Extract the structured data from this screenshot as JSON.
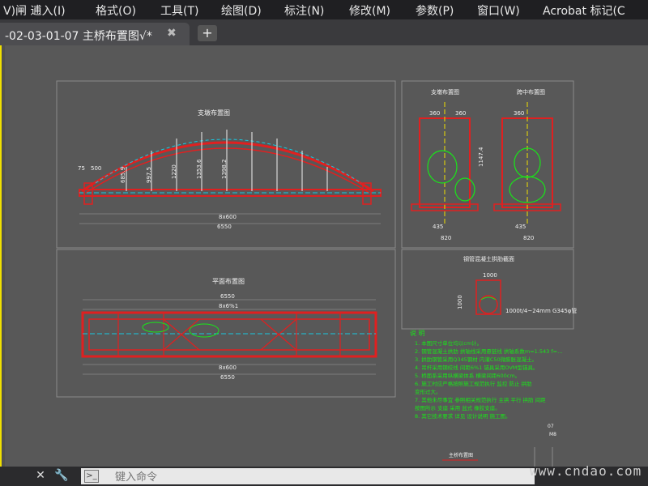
{
  "menu": {
    "items": [
      "V)闸 逋入(I)",
      "格式(O)",
      "工具(T)",
      "绘图(D)",
      "标注(N)",
      "修改(M)",
      "参数(P)",
      "窗口(W)",
      "Acrobat 标记(C"
    ]
  },
  "tab": {
    "title": "-02-03-01-07 主桥布置图√*",
    "close_glyph": "✖",
    "new_glyph": "+"
  },
  "command": {
    "placeholder": "键入命令",
    "close_glyph": "✕",
    "wrench_glyph": "🔧"
  },
  "watermark": "www.cndao.com",
  "drawing": {
    "elevation_title": "立面布置图",
    "plan_title": "平面布置图",
    "section1_title": "支墩布置图",
    "section2_title": "跨中布置图",
    "detail_title": "钢管混凝土拱肋截面",
    "dims": {
      "top_6550": "6550",
      "plan_top": "6550",
      "plan_sub": "8x6%1",
      "bottom_8600": "8x600",
      "bottom_6550": "6550",
      "left_75": "75",
      "left_500": "500",
      "v1": "685.9",
      "v2": "997.5",
      "v3": "1220",
      "v4": "1353.6",
      "v5": "1398.2",
      "s_360a": "360",
      "s_360b": "360",
      "s_435": "435",
      "s_820": "820",
      "s_1147": "1147.4",
      "c_360": "360",
      "c_435": "435",
      "c_820": "820",
      "d_1000a": "1000",
      "d_1000b": "1000",
      "d_note": "1000t/4~24mm G345φ管"
    },
    "notes_title": "说 明",
    "notes": [
      "1. 本图尺寸单位均以cm计。",
      "2. 钢管混凝土拱肋 拱轴线采用悬链线 拱轴系数m=1.543 f=…",
      "3. 拱肋钢管采用Q345钢材 内灌C50微膨胀混凝土。",
      "4. 吊杆采用钢绞线 间距6%1 锚具采用OVM型锚具。",
      "5. 桥面系采用纵横梁体系 横梁间距600cm。",
      "6. 施工时应严格按照施工规范执行 监控 防止 拱肋",
      "   变形过大。",
      "7. 其他未尽事宜 参照相关规范执行 主拱 平行 拱肋 间距",
      "   按图所示 支座 采用 盆式 橡胶支座。",
      "8. 其它技术要求 详见 设计说明 施工图。"
    ],
    "stamp_text": "07",
    "stamp_sub": "M8",
    "footer_title": "主桥布置图"
  },
  "colors": {
    "canvas": "#585858",
    "line_gray": "#8a8a8a",
    "red": "#e02020",
    "green": "#19e619",
    "cyan": "#18c8e0",
    "white": "#f0f0f0",
    "yellow": "#f0e000"
  }
}
